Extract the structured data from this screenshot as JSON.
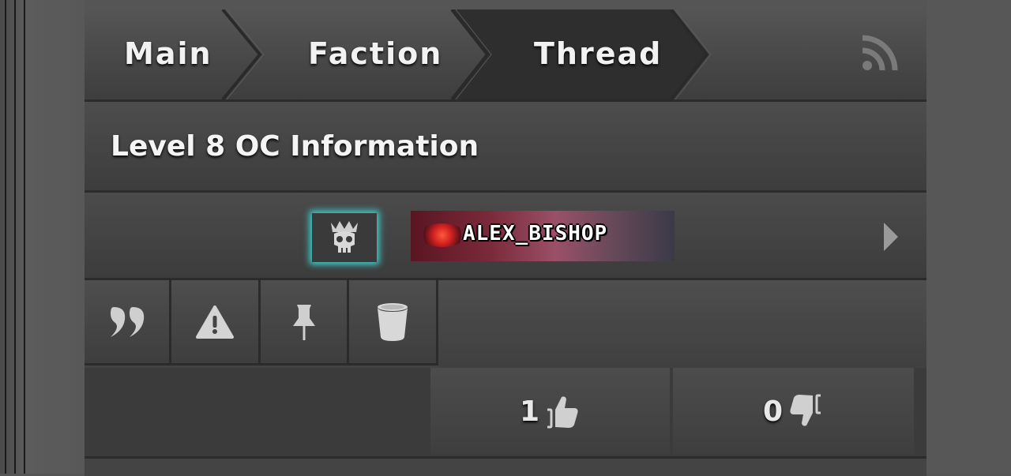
{
  "breadcrumb": {
    "items": [
      {
        "label": "Main"
      },
      {
        "label": "Faction"
      },
      {
        "label": "Thread"
      }
    ]
  },
  "thread": {
    "title": "Level 8 OC Information"
  },
  "author": {
    "name": "ALEX_BISHOP"
  },
  "actions": [
    "quote-icon",
    "report-icon",
    "pin-icon",
    "delete-icon"
  ],
  "votes": {
    "likes": "1",
    "dislikes": "0"
  },
  "colors": {
    "badge_glow": "#3fd6d6",
    "panel": "#3f3f3f"
  }
}
